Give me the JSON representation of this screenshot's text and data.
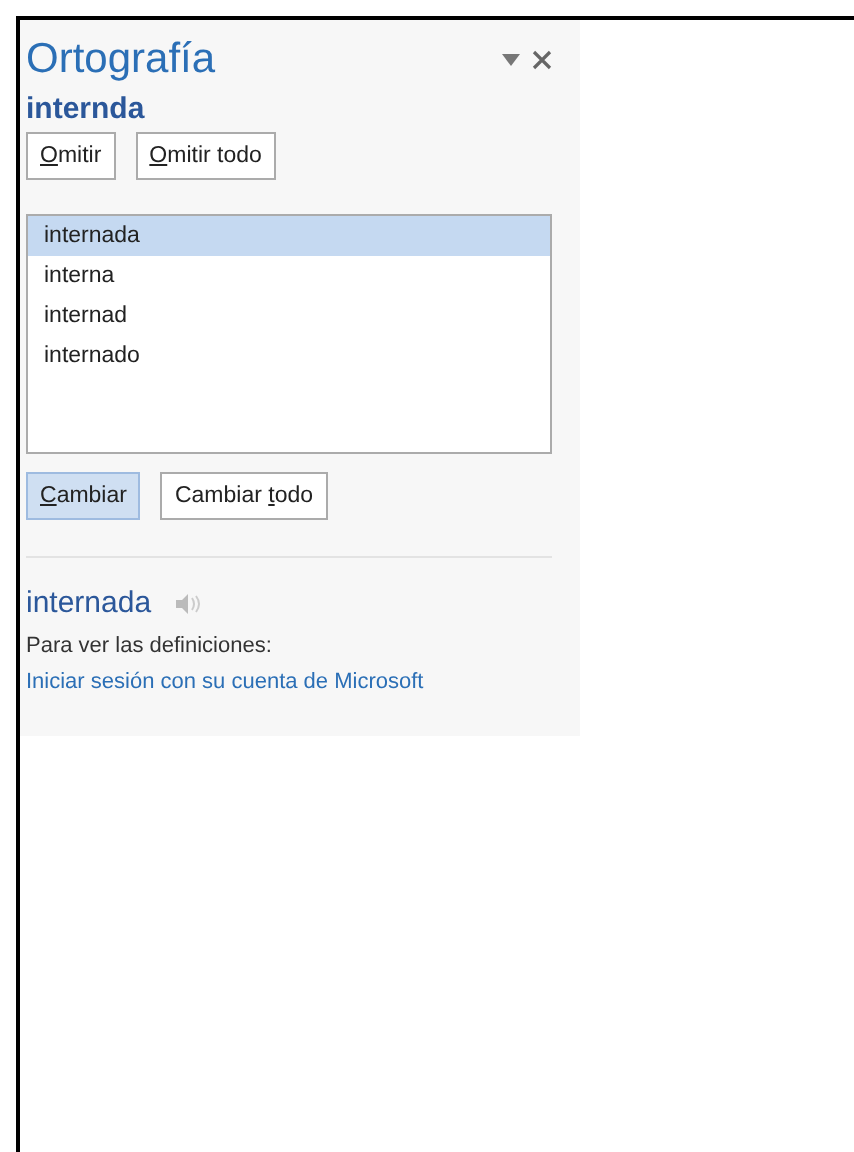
{
  "pane": {
    "title": "Ortografía",
    "word": "internda",
    "top_buttons": [
      {
        "key": "O",
        "after": "mitir",
        "selected": false
      },
      {
        "key": "O",
        "after": "mitir todo",
        "selected": false
      }
    ],
    "suggestions": [
      {
        "label": "internada",
        "selected": true
      },
      {
        "label": "interna",
        "selected": false
      },
      {
        "label": "internad",
        "selected": false
      },
      {
        "label": "internado",
        "selected": false
      }
    ],
    "change_buttons": [
      {
        "key": "C",
        "after": "ambiar",
        "selected": true
      },
      {
        "before": "Cambiar ",
        "key": "t",
        "after": "odo",
        "selected": false
      }
    ],
    "definition": {
      "word": "internada",
      "hint": "Para ver las definiciones:",
      "link": "Iniciar sesión con su cuenta de Microsoft"
    }
  }
}
